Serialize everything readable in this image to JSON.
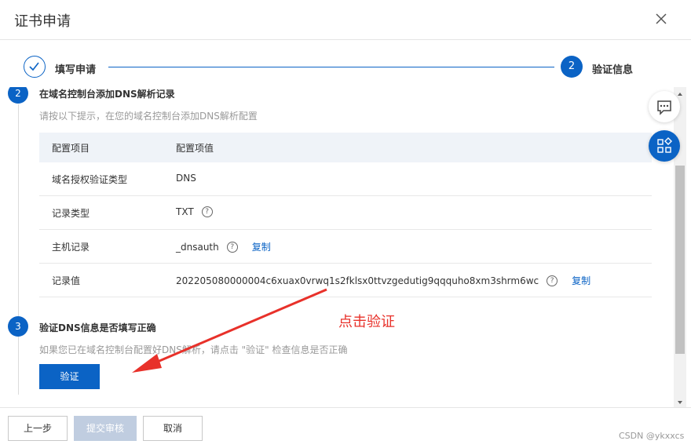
{
  "dialog": {
    "title": "证书申请"
  },
  "steps": [
    {
      "label": "填写申请",
      "state": "done"
    },
    {
      "number": "2",
      "label": "验证信息",
      "state": "active"
    }
  ],
  "section2": {
    "number": "2",
    "title": "在域名控制台添加DNS解析记录",
    "desc": "请按以下提示，在您的域名控制台添加DNS解析配置"
  },
  "table": {
    "headers": [
      "配置项目",
      "配置项值"
    ],
    "rows": [
      {
        "label": "域名授权验证类型",
        "value": "DNS"
      },
      {
        "label": "记录类型",
        "value": "TXT"
      },
      {
        "label": "主机记录",
        "value": "_dnsauth",
        "copy": "复制"
      },
      {
        "label": "记录值",
        "value": "202205080000004c6xuax0vrwq1s2fklsx0ttvzgedutig9qqquho8xm3shrm6wc",
        "copy": "复制"
      }
    ]
  },
  "section3": {
    "number": "3",
    "title": "验证DNS信息是否填写正确",
    "desc": "如果您已在域名控制台配置好DNS解析，请点击 \"验证\" 检查信息是否正确",
    "verify_label": "验证"
  },
  "annotation": {
    "text": "点击验证",
    "color": "#e8312a"
  },
  "footer": {
    "prev_label": "上一步",
    "submit_label": "提交审核",
    "cancel_label": "取消"
  },
  "watermark": "CSDN @ykxxcs",
  "colors": {
    "accent": "#0b63c5",
    "annotation": "#e8312a"
  }
}
